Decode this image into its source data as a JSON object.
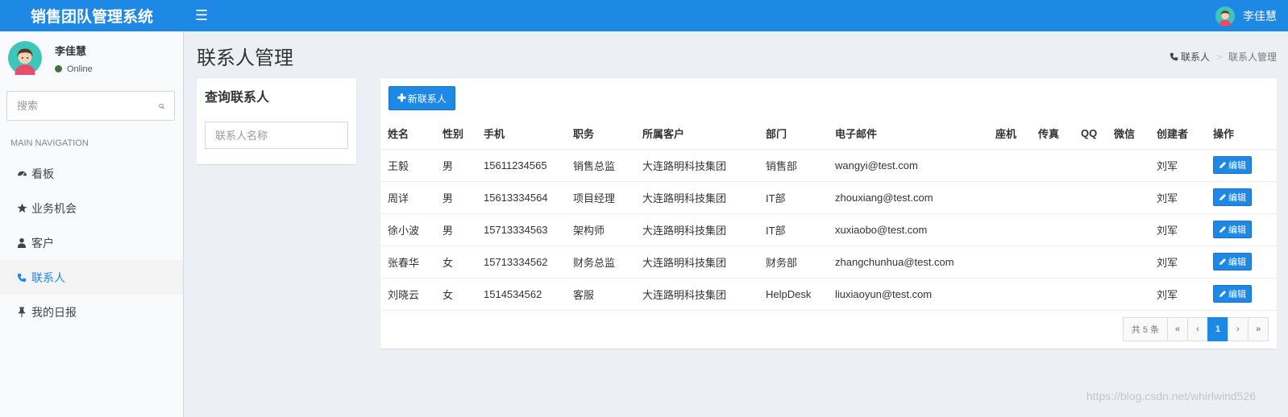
{
  "app": {
    "title": "销售团队管理系统",
    "menu_icon": "hamburger-icon"
  },
  "top_user": {
    "name": "李佳慧"
  },
  "sidebar": {
    "user": {
      "name": "李佳慧",
      "status": "Online",
      "status_color": "#3c763d"
    },
    "search": {
      "placeholder": "搜索"
    },
    "nav_header": "MAIN NAVIGATION",
    "items": [
      {
        "label": "看板",
        "icon": "dashboard-icon",
        "active": false
      },
      {
        "label": "业务机会",
        "icon": "star-icon",
        "active": false
      },
      {
        "label": "客户",
        "icon": "user-icon",
        "active": false
      },
      {
        "label": "联系人",
        "icon": "phone-icon",
        "active": true
      },
      {
        "label": "我的日报",
        "icon": "pin-icon",
        "active": false
      }
    ]
  },
  "page": {
    "title": "联系人管理"
  },
  "breadcrumb": {
    "items": [
      "联系人",
      "联系人管理"
    ]
  },
  "search_box": {
    "title": "查询联系人",
    "placeholder": "联系人名称"
  },
  "toolbar": {
    "new_label": "新联系人"
  },
  "table": {
    "headers": [
      "姓名",
      "性别",
      "手机",
      "职务",
      "所属客户",
      "部门",
      "电子邮件",
      "座机",
      "传真",
      "QQ",
      "微信",
      "创建者",
      "操作"
    ],
    "rows": [
      [
        "王毅",
        "男",
        "15611234565",
        "销售总监",
        "大连路明科技集团",
        "销售部",
        "wangyi@test.com",
        "",
        "",
        "",
        "",
        "刘军"
      ],
      [
        "周详",
        "男",
        "15613334564",
        "项目经理",
        "大连路明科技集团",
        "IT部",
        "zhouxiang@test.com",
        "",
        "",
        "",
        "",
        "刘军"
      ],
      [
        "徐小波",
        "男",
        "15713334563",
        "架构师",
        "大连路明科技集团",
        "IT部",
        "xuxiaobo@test.com",
        "",
        "",
        "",
        "",
        "刘军"
      ],
      [
        "张春华",
        "女",
        "15713334562",
        "财务总监",
        "大连路明科技集团",
        "财务部",
        "zhangchunhua@test.com",
        "",
        "",
        "",
        "",
        "刘军"
      ],
      [
        "刘晓云",
        "女",
        "1514534562",
        "客服",
        "大连路明科技集团",
        "HelpDesk",
        "liuxiaoyun@test.com",
        "",
        "",
        "",
        "",
        "刘军"
      ]
    ],
    "edit_label": "编辑"
  },
  "pagination": {
    "total": "共 5 条",
    "first": "«",
    "prev": "‹",
    "current": "1",
    "next": "›",
    "last": "»"
  },
  "watermark": "https://blog.csdn.net/whirlwind526",
  "colors": {
    "accent": "#1e88e5",
    "background": "#ecf0f5"
  }
}
